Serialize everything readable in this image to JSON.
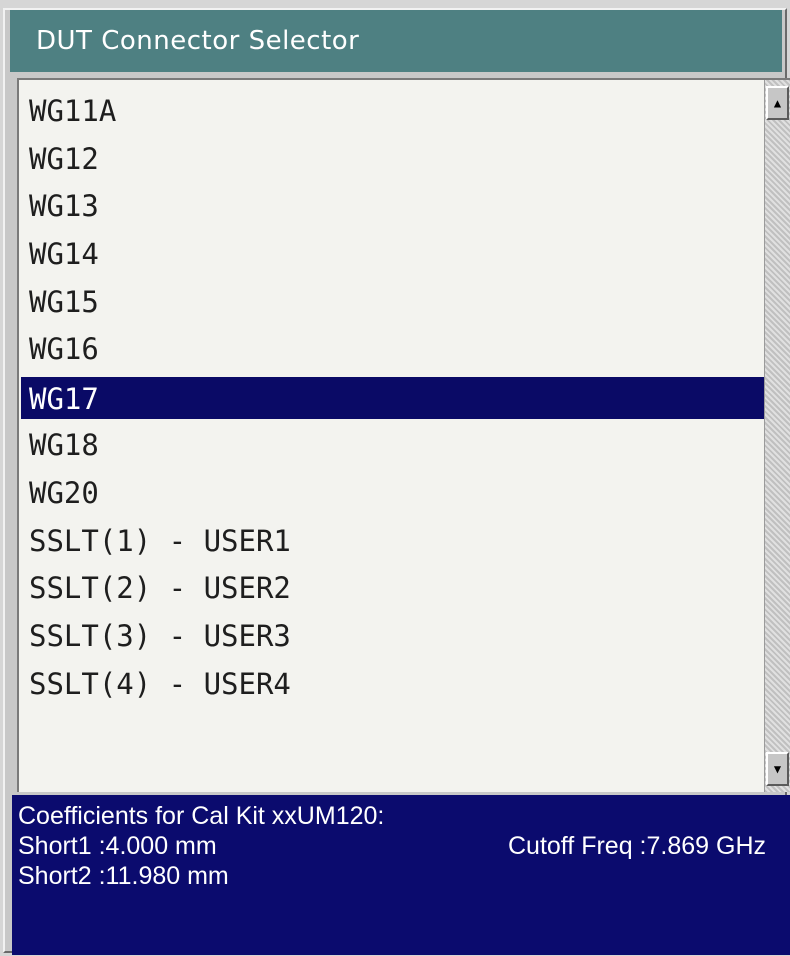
{
  "dialog": {
    "title": "DUT Connector Selector"
  },
  "connector_list": {
    "items": [
      "WG11A",
      "WG12",
      "WG13",
      "WG14",
      "WG15",
      "WG16",
      "WG17",
      "WG18",
      "WG20",
      "SSLT(1) - USER1",
      "SSLT(2) - USER2",
      "SSLT(3) - USER3",
      "SSLT(4) - USER4"
    ],
    "selected": "WG17"
  },
  "scrollbar": {
    "up_icon": "▲",
    "down_icon": "▼"
  },
  "info": {
    "heading": "Coefficients for Cal Kit xxUM120:",
    "short1": "Short1 :4.000 mm",
    "cutoff": "Cutoff Freq :7.869 GHz",
    "short2": "Short2 :11.980 mm"
  },
  "colors": {
    "title_bg": "#4e8082",
    "selection_bg": "#0a0a66",
    "info_bg": "#0b0b6e"
  }
}
